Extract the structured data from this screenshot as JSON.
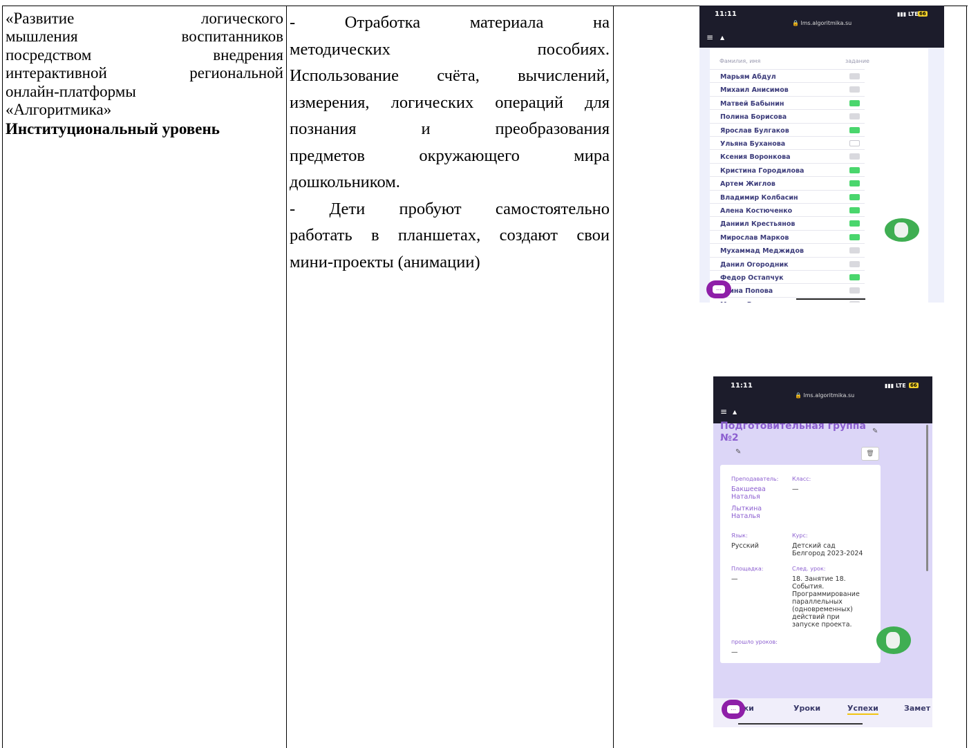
{
  "col1": {
    "line1": "«Развитие логического",
    "line2": "мышления воспитанников",
    "line3": "посредством внедрения",
    "line4": "интерактивной региональной",
    "line5": "онлайн-платформы",
    "line6": "«Алгоритмика»",
    "level": "Институциональный уровень"
  },
  "col2": {
    "l1": "- Отработка материала на",
    "l2": "методических пособиях.",
    "l3": "Использование счёта, вычислений,",
    "l4": "измерения, логических операций для",
    "l5": "познания и преобразования",
    "l6": "предметов окружающего мира",
    "l7": "дошкольником.",
    "l8": "- Дети пробуют самостоятельно",
    "l9": "работать в планшетах, создают свои",
    "l10": "мини-проекты (анимации)"
  },
  "phone1": {
    "time": "11:11",
    "signal": "LTE",
    "battery": "66",
    "url": "lms.algoritmika.su",
    "col_name": "Фамилия, имя",
    "col_task": "задание",
    "students": [
      {
        "name": "Марьям Абдул",
        "status": "gray"
      },
      {
        "name": "Михаил Анисимов",
        "status": "gray"
      },
      {
        "name": "Матвей Бабынин",
        "status": "green"
      },
      {
        "name": "Полина Борисова",
        "status": "gray"
      },
      {
        "name": "Ярослав Булгаков",
        "status": "green"
      },
      {
        "name": "Ульяна Буханова",
        "status": "white"
      },
      {
        "name": "Ксения Воронкова",
        "status": "gray"
      },
      {
        "name": "Кристина Городилова",
        "status": "green"
      },
      {
        "name": "Артем Жиглов",
        "status": "green"
      },
      {
        "name": "Владимир Колбасин",
        "status": "green"
      },
      {
        "name": "Алена Костюченко",
        "status": "green"
      },
      {
        "name": "Даниил Крестьянов",
        "status": "green"
      },
      {
        "name": "Мирослав Марков",
        "status": "green"
      },
      {
        "name": "Мухаммад Меджидов",
        "status": "gray"
      },
      {
        "name": "Данил Огородник",
        "status": "gray"
      },
      {
        "name": "Федор Остапчук",
        "status": "green"
      },
      {
        "name": "ерина Попова",
        "status": "gray"
      },
      {
        "name": "Мария Радомская",
        "status": "gray"
      }
    ]
  },
  "phone2": {
    "time": "11:11",
    "signal": "LTE",
    "battery": "66",
    "url": "lms.algoritmika.su",
    "title1": "Подготовительная группа",
    "title2": "№2",
    "teacher_label": "Преподаватель:",
    "teacher1a": "Бакшеева",
    "teacher1b": "Наталья",
    "teacher2a": "Лыткина",
    "teacher2b": "Наталья",
    "class_label": "Класс:",
    "class_value": "—",
    "lang_label": "Язык:",
    "lang_value": "Русский",
    "course_label": "Курс:",
    "course_value1": "Детский сад",
    "course_value2": "Белгород 2023-2024",
    "site_label": "Площадка:",
    "site_value": "—",
    "next_label": "След. урок:",
    "next_lines": [
      "18. Занятие 18.",
      "События.",
      "Программирование",
      "параллельных",
      "(одновременных)",
      "действий при",
      "запуске проекта."
    ],
    "past_label": "прошло уроков:",
    "past_value": "—",
    "tabs": [
      "ики",
      "Уроки",
      "Успехи",
      "Замет"
    ]
  },
  "colors": {
    "accent": "#8c5fd0",
    "green": "#4ad66d",
    "dark": "#1c1c2b"
  }
}
